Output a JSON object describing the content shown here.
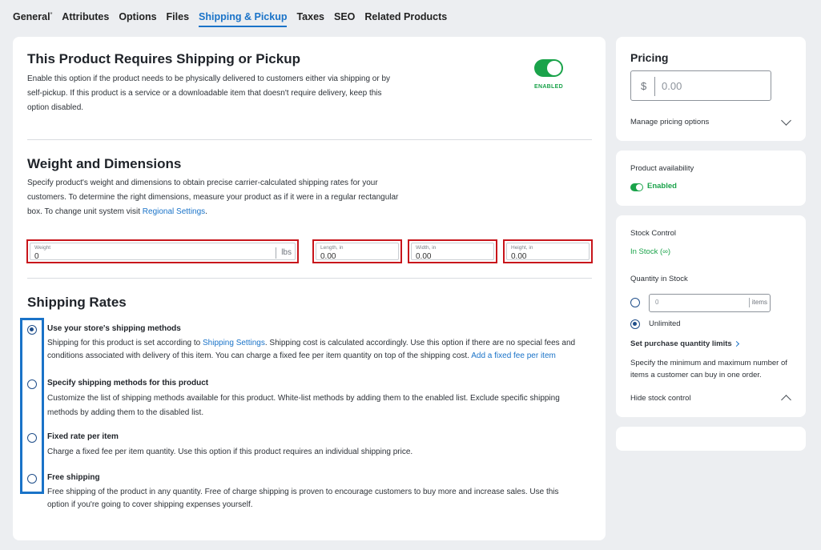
{
  "tabs": [
    {
      "label": "General",
      "marker": "*"
    },
    {
      "label": "Attributes"
    },
    {
      "label": "Options"
    },
    {
      "label": "Files"
    },
    {
      "label": "Shipping & Pickup",
      "active": true
    },
    {
      "label": "Taxes"
    },
    {
      "label": "SEO"
    },
    {
      "label": "Related Products"
    }
  ],
  "shipping_required": {
    "title": "This Product Requires Shipping or Pickup",
    "description": "Enable this option if the product needs to be physically delivered to customers either via shipping or by self-pickup. If this product is a service or a downloadable item that doesn't require delivery, keep this option disabled.",
    "toggle_label": "ENABLED",
    "enabled": true
  },
  "weight_dimensions": {
    "title": "Weight and Dimensions",
    "description": "Specify product's weight and dimensions to obtain precise carrier-calculated shipping rates for your customers. To determine the right dimensions, measure your product as if it were in a regular rectangular box. To change unit system visit",
    "link": "Regional Settings",
    "link_suffix": ".",
    "fields": {
      "weight": {
        "caption": "Weight",
        "value": "0",
        "unit": "lbs"
      },
      "length": {
        "caption": "Length, in",
        "value": "0.00"
      },
      "width": {
        "caption": "Width, in",
        "value": "0.00"
      },
      "height": {
        "caption": "Height, in",
        "value": "0.00"
      }
    }
  },
  "shipping_rates": {
    "title": "Shipping Rates",
    "options": [
      {
        "title": "Use your store's shipping methods",
        "desc_before": "Shipping for this product is set according to",
        "desc_link": "Shipping Settings",
        "desc_after": ". Shipping cost is calculated accordingly. Use this option if there are no special fees and conditions associated with delivery of this item. You can charge a fixed fee per item quantity on top of the shipping cost.",
        "desc_link2": "Add a fixed fee per item",
        "checked": true
      },
      {
        "title": "Specify shipping methods for this product",
        "desc": "Customize the list of shipping methods available for this product. White-list methods by adding them to the enabled list. Exclude specific shipping methods by adding them to the disabled list.",
        "checked": false
      },
      {
        "title": "Fixed rate per item",
        "desc": "Charge a fixed fee per item quantity. Use this option if this product requires an individual shipping price.",
        "checked": false
      },
      {
        "title": "Free shipping",
        "desc": "Free shipping of the product in any quantity. Free of charge shipping is proven to encourage customers to buy more and increase sales. Use this option if you're going to cover shipping expenses yourself.",
        "checked": false
      }
    ]
  },
  "pricing": {
    "title": "Pricing",
    "currency_symbol": "$",
    "placeholder": "0.00",
    "manage_link": "Manage pricing options"
  },
  "availability": {
    "title": "Product availability",
    "status": "Enabled"
  },
  "stock": {
    "title": "Stock Control",
    "status": "In Stock (∞)",
    "quantity_title": "Quantity in Stock",
    "quantity_placeholder": "0",
    "quantity_unit": "items",
    "unlimited_label": "Unlimited",
    "limits_link": "Set purchase quantity limits",
    "limits_desc": "Specify the minimum and maximum number of items a customer can buy in one order.",
    "hide_link": "Hide stock control"
  },
  "colors": {
    "accent": "#1a73c8",
    "success": "#1aa34a",
    "highlight_red": "#c8151b",
    "highlight_blue": "#1a73c8"
  }
}
